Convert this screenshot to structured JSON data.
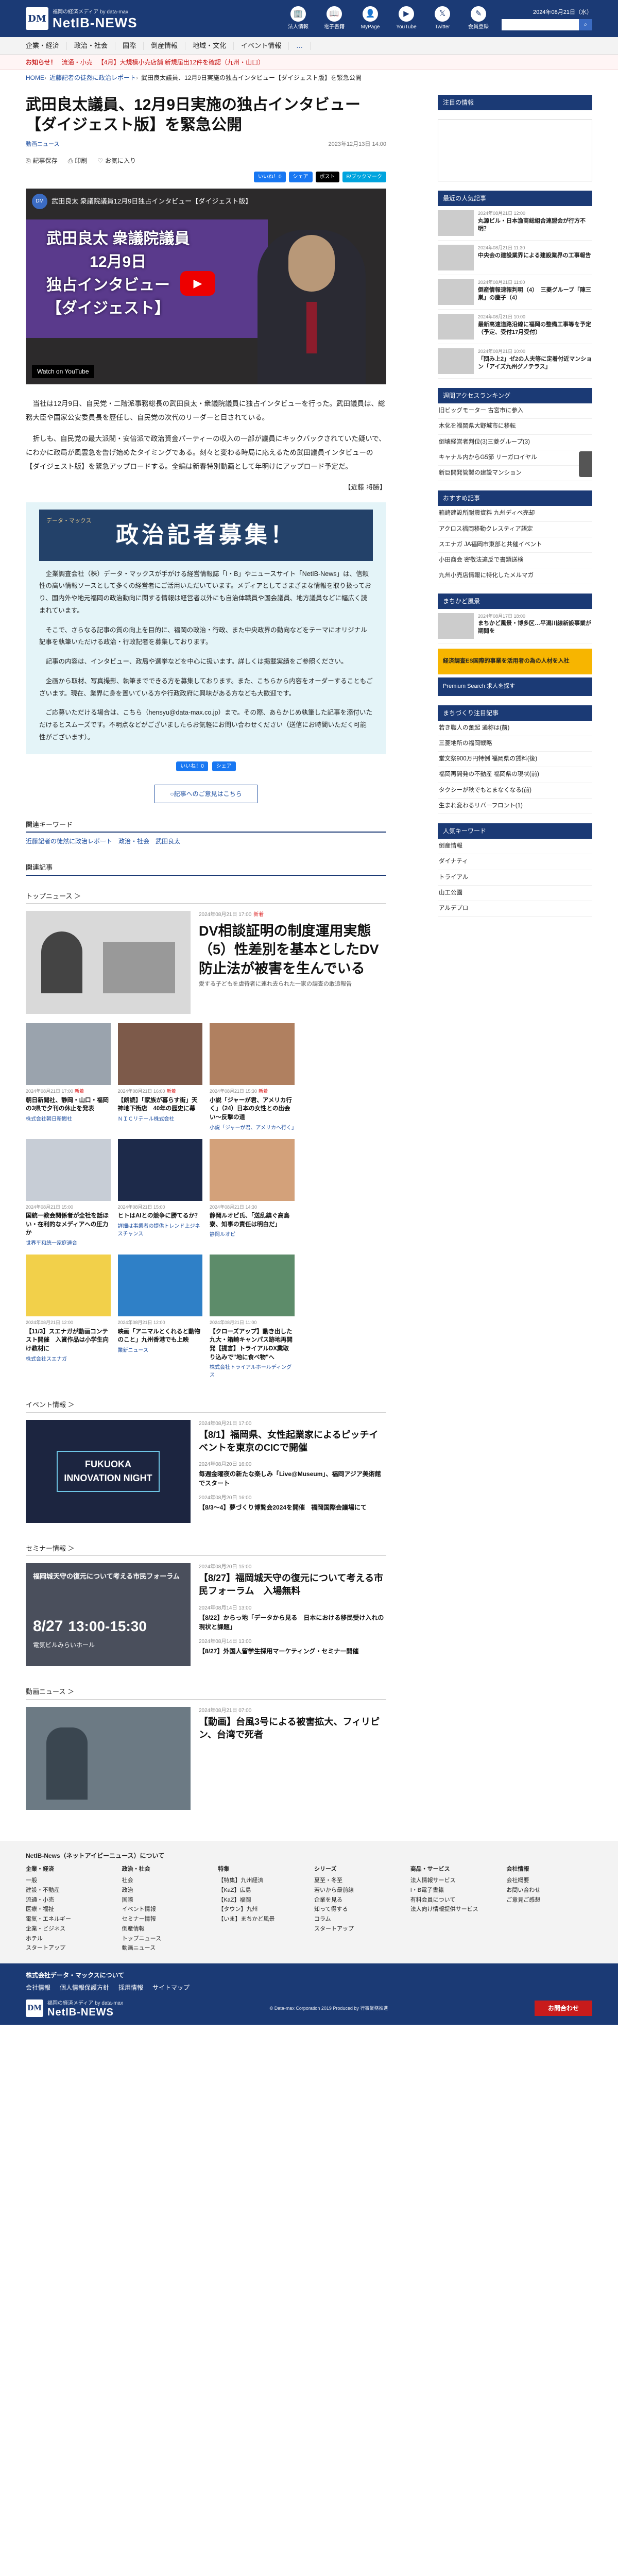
{
  "header": {
    "logo_sub": "福岡の経済メディア by data-max",
    "logo_name": "NetIB-NEWS",
    "logo_mark": "DM",
    "icons": [
      {
        "name": "corporate-info-icon",
        "label": "法人情報",
        "glyph": "🏢"
      },
      {
        "name": "ebook-icon",
        "label": "電子書籍",
        "glyph": "📖"
      },
      {
        "name": "mypage-icon",
        "label": "MyPage",
        "glyph": "👤"
      },
      {
        "name": "youtube-icon",
        "label": "YouTube",
        "glyph": "▶"
      },
      {
        "name": "twitter-icon",
        "label": "Twitter",
        "glyph": "𝕏"
      },
      {
        "name": "member-icon",
        "label": "会員登録",
        "glyph": "✎"
      }
    ],
    "date": "2024年08月21日（水）",
    "search_placeholder": ""
  },
  "gnav": [
    "企業・経済",
    "政治・社会",
    "国際",
    "倒産情報",
    "地域・文化",
    "イベント情報",
    "…"
  ],
  "notice": {
    "label": "お知らせ！",
    "items": [
      "流通・小売",
      "【4月】大規模小売店舗 新規届出12件を確認（九州・山口）"
    ]
  },
  "breadcrumb": [
    "HOME",
    "近藤記者の徒然に政治レポート",
    "武田良太議員、12月9日実施の独占インタビュー【ダイジェスト版】を緊急公開"
  ],
  "article": {
    "title": "武田良太議員、12月9日実施の独占インタビュー【ダイジェスト版】を緊急公開",
    "category": "動画ニュース",
    "date": "2023年12月13日 14:00",
    "tools": {
      "pdf": "記事保存",
      "print": "印刷",
      "favorite": "お気に入り"
    },
    "share": {
      "like": "いいね！0",
      "share": "シェア",
      "x": "ポスト",
      "hatena": "B!ブックマーク"
    },
    "video": {
      "channel": "武田良太 衆議院議員12月9日独占インタビュー【ダイジェスト版】",
      "overlay_line1": "武田良太 衆議院議員",
      "overlay_line2": "12月9日",
      "overlay_line3": "独占インタビュー",
      "overlay_line4": "【ダイジェスト】",
      "watch": "Watch on YouTube"
    },
    "paragraphs": [
      "当社は12月9日、自民党・二階派事務総長の武田良太・衆議院議員に独占インタビューを行った。武田議員は、総務大臣や国家公安委員長を歴任し、自民党の次代のリーダーと目されている。",
      "折しも、自民党の最大派閥・安倍派で政治資金パーティーの収入の一部が議員にキックバックされていた疑いで、にわかに政局が風雲急を告げ始めたタイミングである。刻々と変わる時局に応えるため武田議員インタビューの【ダイジェスト版】を緊急アップロードする。全編は新春特別動画として年明けにアップロード予定だ。"
    ],
    "author": "【近藤 将勝】"
  },
  "recruit": {
    "banner_small": "データ・マックス",
    "banner_big": "政治記者募集！",
    "paragraphs": [
      "企業調査会社（株）データ・マックスが手がける経営情報誌「I・B」やニュースサイト「NetIB-News」は、信頼性の高い情報ソースとして多くの経営者にご活用いただいています。メディアとしてさまざまな情報を取り扱っており、国内外や地元福岡の政治動向に関する情報は経営者以外にも自治体職員や国会議員、地方議員などに幅広く読まれています。",
      "そこで、さらなる記事の質の向上を目的に、福岡の政治・行政、また中央政界の動向などをテーマにオリジナル記事を執筆いただける政治・行政記者を募集しております。",
      "記事の内容は、インタビュー、政局や選挙などを中心に扱います。詳しくは掲載実績をご参照ください。",
      "企画から取材、写真撮影、執筆までできる方を募集しております。また、こちらから内容をオーダーすることもございます。現在、業界に身を置いている方や行政政府に興味がある方なども大歓迎です。",
      "ご応募いただける場合は、こちら（hensyu@data-max.co.jp）まで。その際、あらかじめ執筆した記事を添付いただけるとスムーズです。不明点などがございましたらお気軽にお問い合わせください（送信にお時間いただく可能性がございます）。"
    ]
  },
  "list_link": "○記事へのご意見はこちら",
  "keywords": {
    "title": "関連キーワード",
    "items": [
      "近藤記者の徒然に政治レポート",
      "政治・社会",
      "武田良太"
    ]
  },
  "related_title": "関連記事",
  "topnews": {
    "title": "トップニュース ＞",
    "lead": {
      "date": "2024年08月21日 17:00",
      "new": "新着",
      "headline": "DV相談証明の制度運用実態（5）性差別を基本としたDV防止法が被害を生んでいる",
      "sub": "愛する子どもを虐待者に連れ去られた一家の調査の敢追報告"
    },
    "cards": [
      {
        "date": "2024年08月21日 17:00",
        "new": "新着",
        "title": "朝日新聞社、静岡・山口・福岡の3県で夕刊の休止を発表",
        "source": "株式会社朝日新聞社"
      },
      {
        "date": "2024年08月21日 16:00",
        "new": "新着",
        "title": "【朗読】「家族が暮らす街」天神地下街店　40年の歴史に幕",
        "source": "ＮＩＣリテール株式会社"
      },
      {
        "date": "2024年08月21日 15:30",
        "new": "新着",
        "title": "小説「ジャーが君、アメリカ行く」（24）日本の女性との出会い〜反撃の道",
        "source": "小説「ジャーが君、アメリカへ行く」"
      },
      {
        "date": "",
        "new": "",
        "title": "",
        "source": ""
      },
      {
        "date": "2024年08月21日 15:00",
        "new": "",
        "title": "国統一教会関係者が全社を話ほい・在利的なメディアへの圧力か",
        "source": "世界平和統一家庭連合"
      },
      {
        "date": "2024年08月21日 15:00",
        "new": "",
        "title": "ヒトはAIとの競争に勝てるか？",
        "source": "詳細は事業者の提供トレンド上ジネスチャンス"
      },
      {
        "date": "2024年08月21日 14:30",
        "new": "",
        "title": "静岡ルオピ氏、「送乱鎮ぐ高鳥寮、知事の責任は明白だ」",
        "source": "静岡ルオピ"
      },
      {
        "date": "",
        "new": "",
        "title": "",
        "source": ""
      },
      {
        "date": "2024年08月21日 12:00",
        "new": "",
        "title": "【11/3】スエナガが動画コンテスト開催　入賞作品は小学生向け教材に",
        "source": "株式会社スエナガ"
      },
      {
        "date": "2024年08月21日 12:00",
        "new": "",
        "title": "映画「アニマルとくれると動物のこと」九州香港でも上映",
        "source": "業新ニュース"
      },
      {
        "date": "2024年08月21日 11:00",
        "new": "",
        "title": "【クローズアップ】動き出した九大・箱崎キャンパス跡地再開発【提言】トライアルDX業取り込みで\"地に食べ物\"へ",
        "source": "株式会社トライアルホールディングス"
      },
      {
        "date": "",
        "new": "",
        "title": "",
        "source": ""
      }
    ]
  },
  "events": {
    "title": "イベント情報 ＞",
    "thumb_text": "FUKUOKA INNOVATION NIGHT",
    "items": [
      {
        "date": "2024年08月21日 17:00",
        "title": "【8/1】福岡県、女性起業家によるピッチイベントを東京のCICで開催",
        "big": true
      },
      {
        "date": "2024年08月20日 16:00",
        "title": "毎週金曜夜の新たな楽しみ「Live@Museum」、福岡アジア美術館でスタート",
        "big": false
      },
      {
        "date": "2024年08月20日 16:00",
        "title": "【8/3〜4】夢づくり博覧会2024を開催　福岡国際会議場にて",
        "big": false
      }
    ]
  },
  "seminar": {
    "title": "セミナー情報 ＞",
    "thumb_line1": "福岡城天守の復元について考える市民フォーラム",
    "thumb_date": "8/27",
    "thumb_time": "13:00-15:30",
    "thumb_place": "電気ビルみらいホール",
    "items": [
      {
        "date": "2024年08月20日 15:00",
        "title": "【8/27】福岡城天守の復元について考える市民フォーラム　入場無料",
        "big": true
      },
      {
        "date": "2024年08月14日 13:00",
        "title": "【8/22】からっ地「データから見る　日本における移民受け入れの現状と課題」",
        "big": false
      },
      {
        "date": "2024年08月14日 13:00",
        "title": "【8/27】外国人留学生採用マーケティング・セミナー開催",
        "big": false
      }
    ]
  },
  "video_news": {
    "title": "動画ニュース ＞",
    "date": "2024年08月21日 07:00",
    "title_text": "【動画】台風3号による被害拡大、フィリピン、台湾で死者"
  },
  "sidebar": {
    "ad_text": "",
    "hot_title": "注目の情報",
    "latest_title": "最近の人気記事",
    "latest": [
      {
        "date": "2024年08月21日 12:00",
        "title": "丸源ビル・日本漁商総組合連盟会が行方不明？"
      },
      {
        "date": "2024年08月21日 11:30",
        "title": "中央会の建設業界による建設業界の工事報告"
      },
      {
        "date": "2024年08月21日 11:00",
        "title": "倒産情報速報判明（4）　三菱グループ「陳三巣」の慶子（4）"
      },
      {
        "date": "2024年08月21日 10:00",
        "title": "最新高速道路沿線に福岡の整備工事等を予定（予定、受付17月受付）"
      },
      {
        "date": "2024年08月21日 10:00",
        "title": "「団み上2」ゼ2の人夫等に定着付近マンション「アイズ九州グノテラス」"
      }
    ],
    "ranking_title": "週間アクセスランキング",
    "ranking": [
      "旧ビッグモーター 古宮市に参入",
      "木化を福岡県大野城市に移転",
      "倒壊経営者判位(3)三菱グループ(3)",
      "キャナル内からG5節 リーガロイヤル",
      "新巨開発管製の建設マンション"
    ],
    "recommend_title": "おすすめ記事",
    "recommend": [
      "箱崎建設所耐震資料 九州ディベ売却",
      "アクロス福岡移動クレスティア語定",
      "スエナガ JA福岡市東部と共催イベント",
      "小田商会 密敬法違反で書類送検",
      "九州小売店情報に特化したメルマガ"
    ],
    "town_title": "まちかど風景",
    "town": {
      "date": "2024年08月17日 18:00",
      "title": "まちかど風景・博多区…平潟川線新設事業が期間を"
    },
    "banner1": "経済調査ES国際的事業を活用者の為の人材を入社",
    "banner2": "Premium Search 求人を探す",
    "series_title": "まちづくり注目記事",
    "series": [
      "若き職人の奮起 通称は(前)",
      "三菱地所の福岡戦略",
      "堂文祭900万円特例 福岡県の賃料(後)",
      "福岡再開発の不動産 福岡県の現状(前)",
      "タクシーが秋でもとまなくなる(前)",
      "生まれ変わるリバーフロント(1)"
    ],
    "people_title": "人気キーワード",
    "people": [
      "倒産情報",
      "ダイナティ",
      "トライアル",
      "山工公園",
      "アルデプロ"
    ]
  },
  "footer": {
    "site_title": "NetIB-News（ネットアイビーニュース）について",
    "cols": [
      {
        "head": "企業・経済",
        "items": [
          "一般",
          "建設・不動産",
          "流通・小売",
          "医療・福祉",
          "電気・エネルギー",
          "企業・ビジネス",
          "ホテル",
          "スタートアップ"
        ]
      },
      {
        "head": "政治・社会",
        "items": [
          "社会",
          "政治",
          "国際",
          "イベント情報",
          "セミナー情報",
          "倒産情報",
          "トップニュース",
          "動画ニュース"
        ]
      },
      {
        "head": "特集",
        "items": [
          "【特集】九州経済",
          "【KaZ】広島",
          "【KaZ】福岡",
          "【タウン】九州",
          "【いま】まちかど風景"
        ]
      },
      {
        "head": "シリーズ",
        "items": [
          "夏至・冬至",
          "若いから最前線",
          "企業を見る",
          "知って得する",
          "コラム",
          "スタートアップ"
        ]
      },
      {
        "head": "商品・サービス",
        "items": [
          "法人情報サービス",
          "I・B電子書籍",
          "有料会員について",
          "法人向け情報提供サービス"
        ]
      },
      {
        "head": "会社情報",
        "items": [
          "会社概要",
          "お問い合わせ",
          "ご意見ご感想"
        ]
      }
    ],
    "company": "株式会社データ・マックスについて",
    "links": [
      "会社情報",
      "個人情報保護方針",
      "採用情報",
      "サイトマップ"
    ],
    "copy": "© Data-max Corporation 2019 Produced by 行事業務推進",
    "contact": "お問合わせ"
  }
}
